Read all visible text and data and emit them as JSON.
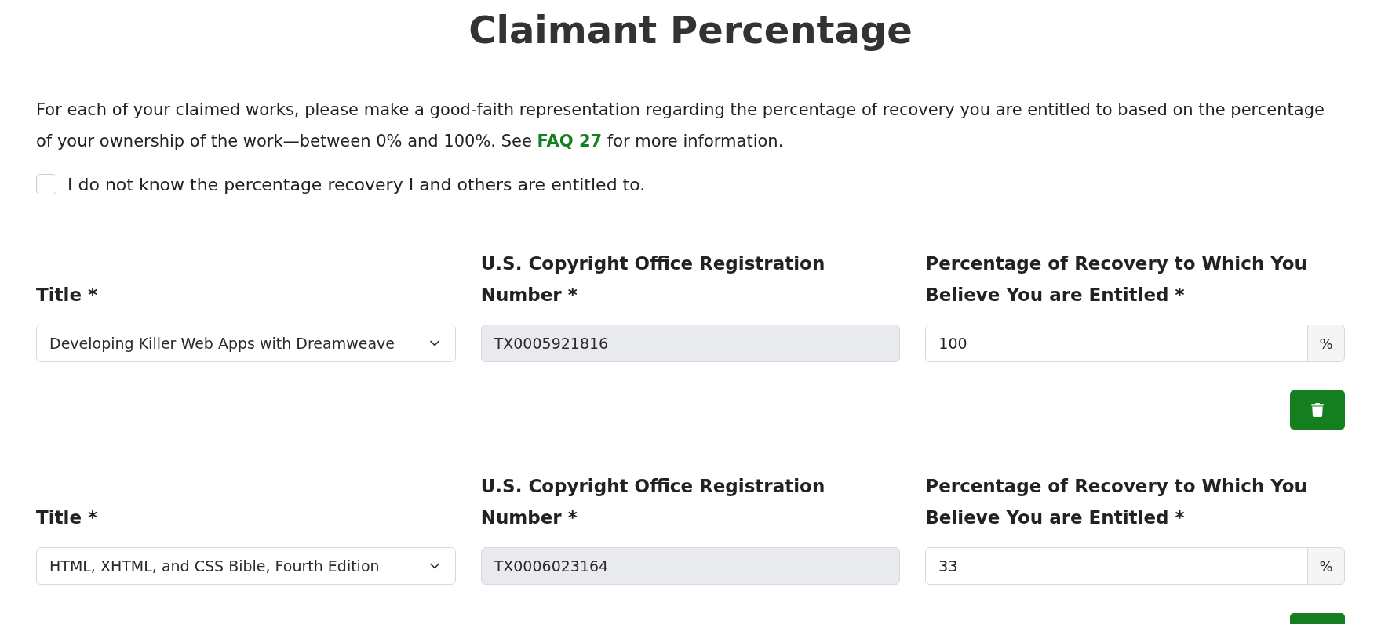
{
  "heading": "Claimant Percentage",
  "intro": "For each of your claimed works, please make a good-faith representation regarding the percentage of recovery you are entitled to based on the percentage of your ownership of the work—between 0% and 100%. See ",
  "intro_link": "FAQ 27",
  "intro_end": " for more information.",
  "unknown_checkbox": {
    "label": "I do not know the percentage recovery I and others are entitled to.",
    "checked": false
  },
  "works": [
    {
      "title_label": "Title *",
      "title": "Developing Killer Web Apps with Dreamweave",
      "registration_label": "U.S. Copyright Office Registration Number *",
      "registration": "TX0005921816",
      "percentage_label": "Percentage of Recovery to Which You Believe You are Entitled *",
      "percentage": "100",
      "unit": "%"
    },
    {
      "title_label": "Title *",
      "title": "HTML, XHTML, and CSS Bible, Fourth Edition",
      "registration_label": "U.S. Copyright Office Registration Number *",
      "registration": "TX0006023164",
      "percentage_label": "Percentage of Recovery to Which You Believe You are Entitled *",
      "percentage": "33",
      "unit": "%"
    }
  ]
}
